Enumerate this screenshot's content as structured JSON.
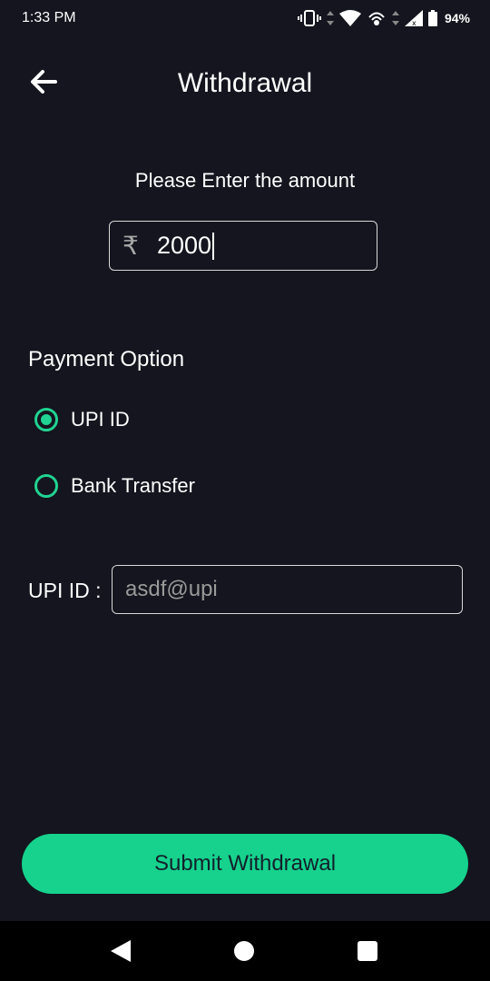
{
  "status_bar": {
    "time": "1:33 PM",
    "battery": "94%",
    "icons": [
      "vibrate-icon",
      "data-arrows-icon",
      "wifi-icon",
      "hotspot-icon",
      "signal-icon",
      "battery-icon"
    ]
  },
  "header": {
    "title": "Withdrawal",
    "back_icon": "arrow-left-icon"
  },
  "amount": {
    "prompt": "Please Enter the amount",
    "currency_symbol": "₹",
    "value": "2000"
  },
  "payment": {
    "section_title": "Payment Option",
    "options": [
      {
        "label": "UPI ID",
        "selected": true
      },
      {
        "label": "Bank Transfer",
        "selected": false
      }
    ]
  },
  "upi": {
    "label": "UPI ID :",
    "value": "asdf@upi"
  },
  "submit_label": "Submit Withdrawal",
  "colors": {
    "background": "#14151e",
    "accent": "#16d28d",
    "radio": "#20d392",
    "nav_bar": "#000000"
  }
}
